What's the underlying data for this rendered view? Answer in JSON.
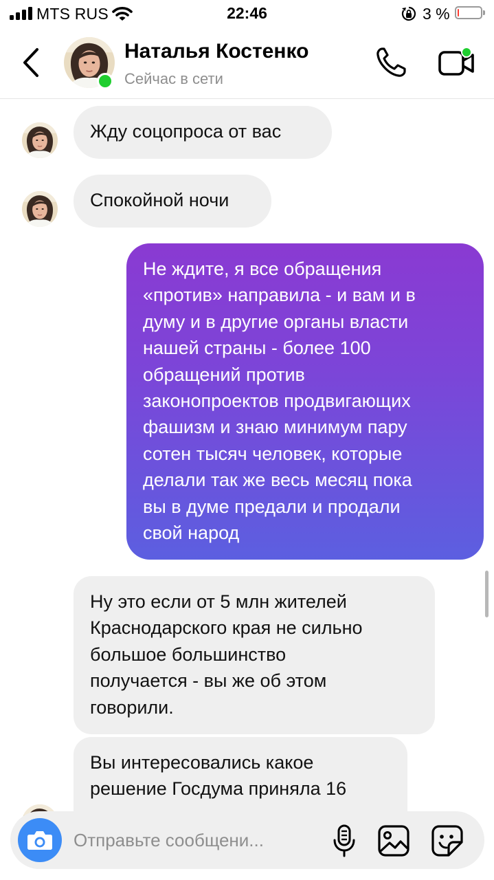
{
  "status_bar": {
    "carrier": "MTS RUS",
    "time": "22:46",
    "battery_percent": "3 %",
    "battery_level": 0.03
  },
  "header": {
    "contact_name": "Наталья Костенко",
    "contact_status": "Сейчас в сети"
  },
  "messages": [
    {
      "direction": "incoming",
      "lines": [
        "Жду соцопроса от вас"
      ]
    },
    {
      "direction": "incoming",
      "lines": [
        "Спокойной ночи"
      ]
    },
    {
      "direction": "outgoing",
      "lines": [
        "Не ждите, я все обращения",
        "«против» направила - и вам и в",
        "думу и в другие органы власти",
        "нашей страны - более 100",
        "обращений против",
        "законопроектов продвигающих",
        "фашизм и знаю минимум пару",
        "сотен тысяч человек, которые",
        "делали так же весь месяц пока",
        "вы в думе предали и продали",
        "свой народ"
      ]
    },
    {
      "direction": "incoming",
      "lines": [
        "Ну это если от 5 млн жителей",
        "Краснодарского края не сильно",
        "большое большинство",
        "получается - вы же об этом",
        "говорили."
      ]
    },
    {
      "direction": "incoming",
      "lines": [
        "Вы интересовались какое",
        "решение Госдума приняла 16"
      ]
    }
  ],
  "composer": {
    "placeholder": "Отправьте сообщени..."
  },
  "colors": {
    "online": "#1fce2f",
    "incoming_bubble": "#efefef",
    "outgoing_gradient_top": "#8a3ad2",
    "outgoing_gradient_bottom": "#5c5fe0",
    "camera_button": "#3c8cf6"
  },
  "icons": [
    "back-chevron-icon",
    "phone-icon",
    "video-camera-icon",
    "camera-icon",
    "microphone-icon",
    "gallery-icon",
    "sticker-icon"
  ]
}
